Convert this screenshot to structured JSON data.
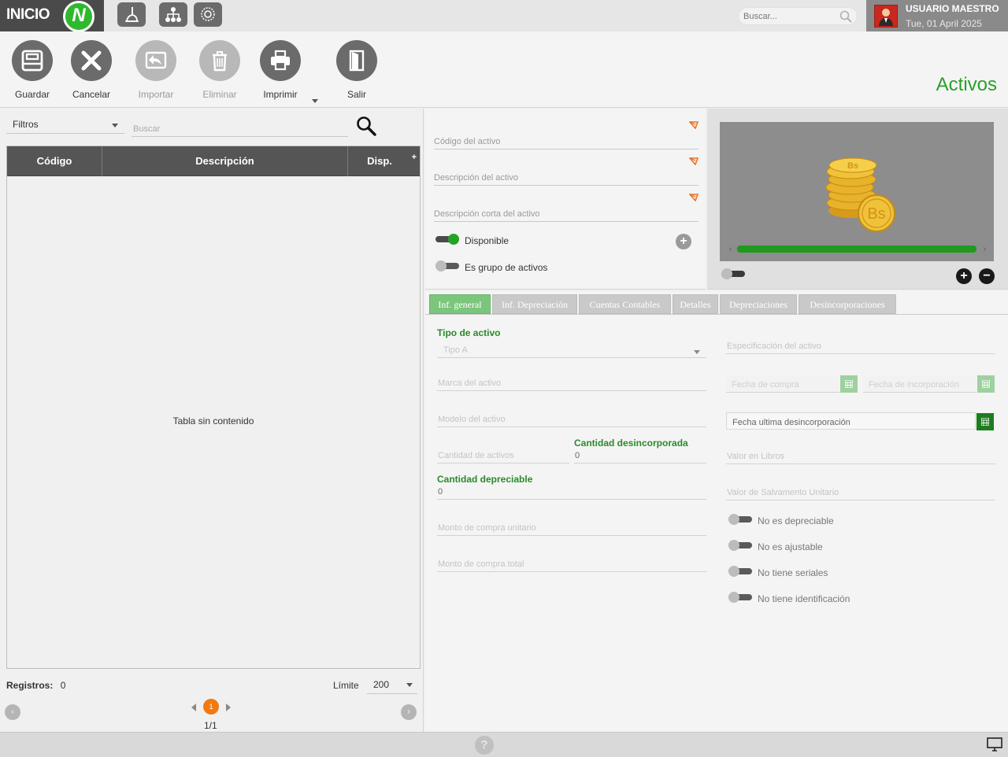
{
  "app": {
    "logo_text": "INICIO",
    "logo_mark": "N",
    "page_title": "Activos"
  },
  "topbar": {
    "icons": [
      "broom-icon",
      "org-chart-icon",
      "settings-gear-icon"
    ],
    "search_placeholder": "Buscar...",
    "user_name": "USUARIO MAESTRO",
    "user_date": "Tue, 01 April 2025"
  },
  "toolbar": {
    "guardar": "Guardar",
    "cancelar": "Cancelar",
    "importar": "Importar",
    "eliminar": "Eliminar",
    "imprimir": "Imprimir",
    "salir": "Salir"
  },
  "left": {
    "filter_label": "Filtros",
    "search_placeholder": "Buscar",
    "columns": [
      "Código",
      "Descripción",
      "Disp."
    ],
    "add_column": "+",
    "empty_message": "Tabla sin contenido",
    "registros_label": "Registros:",
    "registros_value": "0",
    "limite_label": "Límite",
    "limite_value": "200",
    "current_page": "1",
    "page_count": "1/1",
    "nav_left": "‹",
    "nav_right": "›"
  },
  "form": {
    "codigo_placeholder": "Código del activo",
    "descripcion_placeholder": "Descripción del activo",
    "descripcion_corta_placeholder": "Descripción corta del activo",
    "disponible_label": "Disponible",
    "disponible_on": true,
    "grupo_label": "Es grupo de activos",
    "grupo_on": false,
    "plus": "+"
  },
  "image_panel": {
    "scroll_left": "‹",
    "scroll_right": "›",
    "zoom_in": "+",
    "zoom_out": "−",
    "coin_text": "Bs"
  },
  "tabs": [
    {
      "label": "Inf. general",
      "active": true
    },
    {
      "label": "Inf. Depreciación",
      "active": false
    },
    {
      "label": "Cuentas Contables",
      "active": false
    },
    {
      "label": "Detalles",
      "active": false
    },
    {
      "label": "Depreciaciones",
      "active": false
    },
    {
      "label": "Desincorporaciones",
      "active": false
    }
  ],
  "general": {
    "tipo_label": "Tipo de activo",
    "tipo_value": "Tipo A",
    "marca_placeholder": "Marca del activo",
    "modelo_placeholder": "Modelo del activo",
    "cantidad_activos_placeholder": "Cantidad de activos",
    "cantidad_desinc_label": "Cantidad desincorporada",
    "cantidad_desinc_value": "0",
    "cantidad_dep_label": "Cantidad depreciable",
    "cantidad_dep_value": "0",
    "monto_unitario_placeholder": "Monto de compra unitario",
    "monto_total_placeholder": "Monto de compra total",
    "especificacion_placeholder": "Especificación del activo",
    "fecha_compra_placeholder": "Fecha de compra",
    "fecha_incorporacion_placeholder": "Fecha de incorporación",
    "fecha_desinc_placeholder": "Fecha ultima desincorporación",
    "valor_libros_placeholder": "Valor en Libros",
    "valor_salvamento_placeholder": "Valor de Salvamento Unitario",
    "toggles": [
      {
        "label": "No es depreciable",
        "on": false
      },
      {
        "label": "No es ajustable",
        "on": false
      },
      {
        "label": "No tiene seriales",
        "on": false
      },
      {
        "label": "No tiene identificación",
        "on": false
      }
    ]
  },
  "statusbar": {
    "help": "?"
  }
}
